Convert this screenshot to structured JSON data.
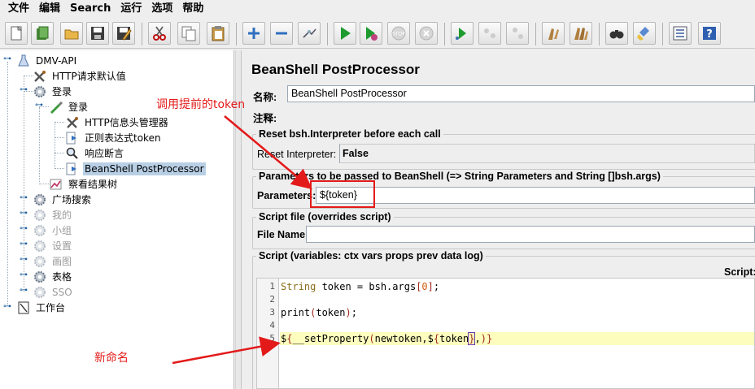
{
  "menubar": {
    "items": [
      "文件",
      "编辑",
      "Search",
      "运行",
      "选项",
      "帮助"
    ]
  },
  "toolbar": {
    "buttons": [
      "new-icon",
      "templates-icon",
      "open-icon",
      "save-icon",
      "save-as-icon",
      "cut-icon",
      "copy-icon",
      "paste-icon",
      "expand-icon",
      "collapse-icon",
      "toggle-icon",
      "start-icon",
      "start-no-pause-icon",
      "stop-icon",
      "shutdown-icon",
      "remote-start-icon",
      "remote-stop-icon",
      "remote-shutdown-icon",
      "clear-icon",
      "clear-all-icon",
      "search-icon",
      "reset-search-icon",
      "function-helper-icon",
      "help-icon"
    ]
  },
  "tree": {
    "nodes": [
      {
        "label": "DMV-API"
      },
      {
        "label": "HTTP请求默认值"
      },
      {
        "label": "登录"
      },
      {
        "label": "登录"
      },
      {
        "label": "HTTP信息头管理器"
      },
      {
        "label": "正则表达式token"
      },
      {
        "label": "响应断言"
      },
      {
        "label": "BeanShell PostProcessor"
      },
      {
        "label": "察看结果树"
      },
      {
        "label": "广场搜索"
      },
      {
        "label": "我的"
      },
      {
        "label": "小组"
      },
      {
        "label": "设置"
      },
      {
        "label": "画图"
      },
      {
        "label": "表格"
      },
      {
        "label": "SSO"
      },
      {
        "label": "工作台"
      }
    ]
  },
  "panel": {
    "title": "BeanShell PostProcessor",
    "name_label": "名称:",
    "name_value": "BeanShell PostProcessor",
    "comment_label": "注释:",
    "comment_value": "",
    "reset_group_title": "Reset bsh.Interpreter before each call",
    "reset_label": "Reset Interpreter:",
    "reset_value": "False",
    "params_group_title": "Parameters to be passed to BeanShell (=> String Parameters and String []bsh.args)",
    "params_label": "Parameters:",
    "params_value": "${token}",
    "scriptfile_group_title": "Script file (overrides script)",
    "filename_label": "File Name:",
    "filename_value": "",
    "script_group_title": "Script (variables: ctx vars props prev data log)",
    "script_label": "Script:"
  },
  "code": {
    "line_numbers": [
      "1",
      "2",
      "3",
      "4",
      "5"
    ],
    "line1": {
      "kw": "String",
      "rest1": " token = bsh.args",
      "br1": "[",
      "num": "0",
      "br2": "]",
      "end": ";"
    },
    "line3": {
      "fn": "print",
      "p1": "(",
      "arg": "token",
      "p2": ")",
      "end": ";"
    },
    "line5": {
      "a": "$",
      "b": "{",
      "c": "__setProperty",
      "d": "(",
      "e": "newtoken,",
      "f": "$",
      "g": "{",
      "h": "token",
      "i": "}",
      "j": ",",
      "k": ")",
      "l": "}"
    }
  },
  "annotations": {
    "top": "调用提前的token",
    "bottom": "新命名"
  },
  "colors": {
    "annotation": "#e31a1a",
    "selection": "#b8cfe5",
    "code_highlight": "#fdfdbe"
  }
}
